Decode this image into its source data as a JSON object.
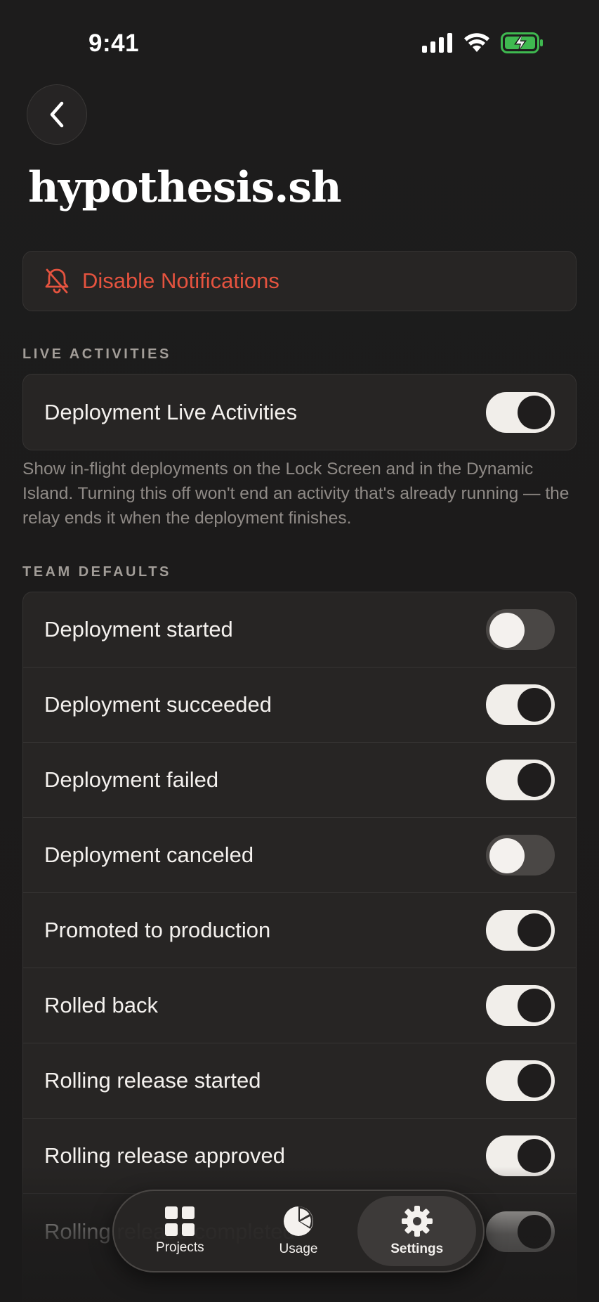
{
  "status_bar": {
    "time": "9:41"
  },
  "page": {
    "title": "hypothesis.sh"
  },
  "notifications": {
    "label": "Disable Notifications",
    "color": "#e5533f"
  },
  "live_activities": {
    "header": "LIVE ACTIVITIES",
    "items": [
      {
        "label": "Deployment Live Activities",
        "on": true
      }
    ],
    "footnote": "Show in-flight deployments on the Lock Screen and in the Dynamic Island. Turning this off won't end an activity that's already running — the relay ends it when the deployment finishes."
  },
  "team_defaults": {
    "header": "TEAM DEFAULTS",
    "items": [
      {
        "label": "Deployment started",
        "on": false
      },
      {
        "label": "Deployment succeeded",
        "on": true
      },
      {
        "label": "Deployment failed",
        "on": true
      },
      {
        "label": "Deployment canceled",
        "on": false
      },
      {
        "label": "Promoted to production",
        "on": true
      },
      {
        "label": "Rolled back",
        "on": true
      },
      {
        "label": "Rolling release started",
        "on": true
      },
      {
        "label": "Rolling release approved",
        "on": true
      },
      {
        "label": "Rolling release completed",
        "on": true
      }
    ]
  },
  "tab_bar": {
    "tabs": [
      {
        "label": "Projects",
        "icon": "grid-icon",
        "active": false
      },
      {
        "label": "Usage",
        "icon": "pie-chart-icon",
        "active": false
      },
      {
        "label": "Settings",
        "icon": "gear-icon",
        "active": true
      }
    ]
  }
}
